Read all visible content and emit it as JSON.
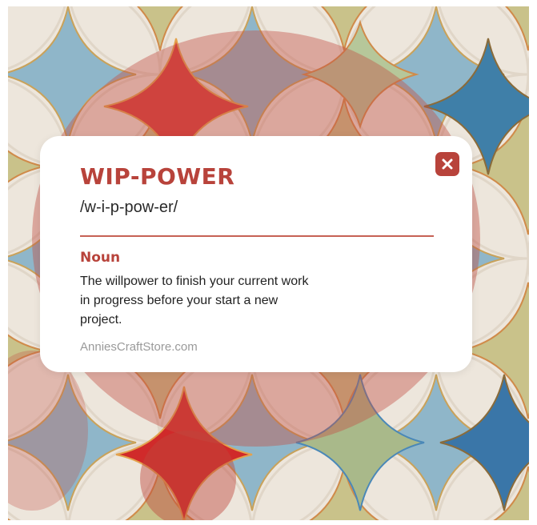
{
  "card": {
    "word": "WIP-POWER",
    "pronunciation": "/w-i-p-pow-er/",
    "part_of_speech": "Noun",
    "definition": "The willpower to finish your current work in progress before your start a new project.",
    "source": "AnniesCraftStore.com"
  },
  "icons": {
    "close": "close-icon"
  },
  "colors": {
    "accent": "#b8433b",
    "divider": "#c66155",
    "overlay": "#c45046",
    "card_bg": "#ffffff"
  }
}
